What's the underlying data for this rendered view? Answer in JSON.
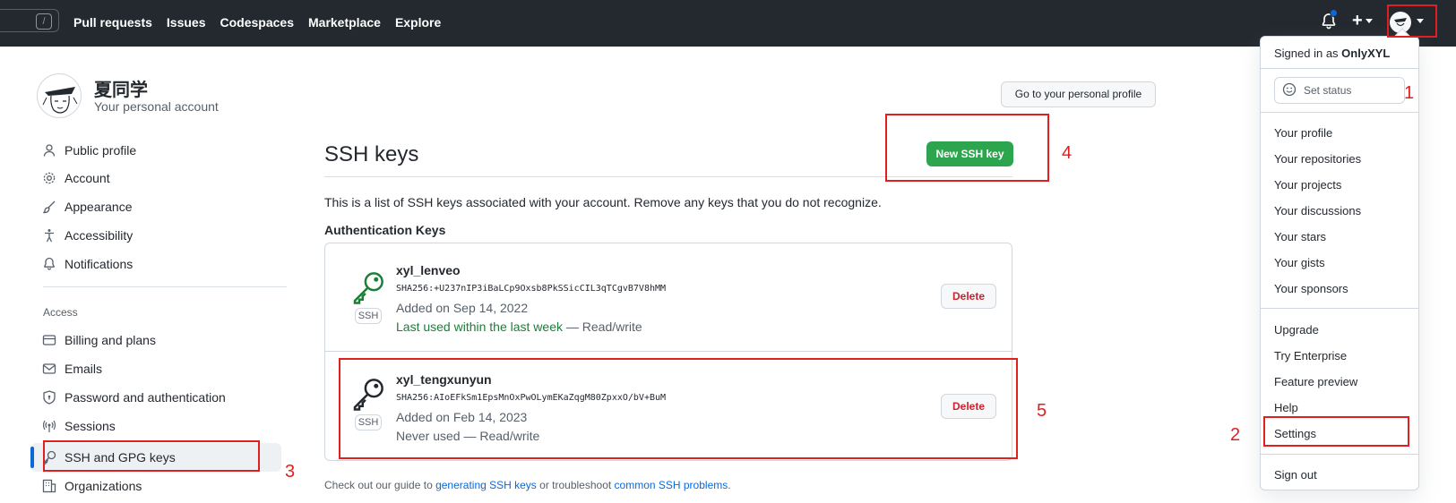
{
  "header": {
    "search_key": "/",
    "nav": [
      "Pull requests",
      "Issues",
      "Codespaces",
      "Marketplace",
      "Explore"
    ],
    "plus_label": "+",
    "accent": "#0969da"
  },
  "profile": {
    "name": "夏同学",
    "subtitle": "Your personal account"
  },
  "sidebar": {
    "items": [
      {
        "label": "Public profile",
        "icon": "person-icon"
      },
      {
        "label": "Account",
        "icon": "gear-icon"
      },
      {
        "label": "Appearance",
        "icon": "paintbrush-icon"
      },
      {
        "label": "Accessibility",
        "icon": "accessibility-icon"
      },
      {
        "label": "Notifications",
        "icon": "bell-icon"
      }
    ],
    "access_heading": "Access",
    "access_items": [
      {
        "label": "Billing and plans",
        "icon": "credit-card-icon"
      },
      {
        "label": "Emails",
        "icon": "mail-icon"
      },
      {
        "label": "Password and authentication",
        "icon": "shield-lock-icon"
      },
      {
        "label": "Sessions",
        "icon": "broadcast-icon"
      },
      {
        "label": "SSH and GPG keys",
        "icon": "key-icon",
        "active": true
      },
      {
        "label": "Organizations",
        "icon": "organization-icon"
      }
    ]
  },
  "main": {
    "goto_profile": "Go to your personal profile",
    "title": "SSH keys",
    "new_key_button": "New SSH key",
    "description": "This is a list of SSH keys associated with your account. Remove any keys that you do not recognize.",
    "auth_heading": "Authentication Keys",
    "keys": [
      {
        "name": "xyl_lenveo",
        "fingerprint": "SHA256:+U237nIP3iBaLCp9Oxsb8PkSSicCIL3qTCgvB7V8hMM",
        "added": "Added on Sep 14, 2022",
        "used_green": "Last used within the last week",
        "used_rest": " — Read/write",
        "badge": "SSH",
        "delete": "Delete",
        "icon_color": "#1a7f37"
      },
      {
        "name": "xyl_tengxunyun",
        "fingerprint": "SHA256:AIoEFkSm1EpsMnOxPwOLymEKaZqgM80ZpxxO/bV+BuM",
        "added": "Added on Feb 14, 2023",
        "used_green": "",
        "used_rest": "Never used — Read/write",
        "badge": "SSH",
        "delete": "Delete",
        "icon_color": "#24292f"
      }
    ],
    "guide_prefix": "Check out our guide to ",
    "guide_link1": "generating SSH keys",
    "guide_middle": " or troubleshoot ",
    "guide_link2": "common SSH problems",
    "guide_suffix": "."
  },
  "dropdown": {
    "signed_in_prefix": "Signed in as ",
    "username": "OnlyXYL",
    "set_status": "Set status",
    "group1": [
      "Your profile",
      "Your repositories",
      "Your projects",
      "Your discussions",
      "Your stars",
      "Your gists",
      "Your sponsors"
    ],
    "group2": [
      "Upgrade",
      "Try Enterprise",
      "Feature preview",
      "Help",
      "Settings"
    ],
    "sign_out": "Sign out"
  },
  "annotations": [
    "1",
    "2",
    "3",
    "4",
    "5"
  ],
  "colors": {
    "annotation": "#e02020",
    "header_bg": "#24292f",
    "primary_button": "#2da44e",
    "danger": "#cf222e"
  }
}
